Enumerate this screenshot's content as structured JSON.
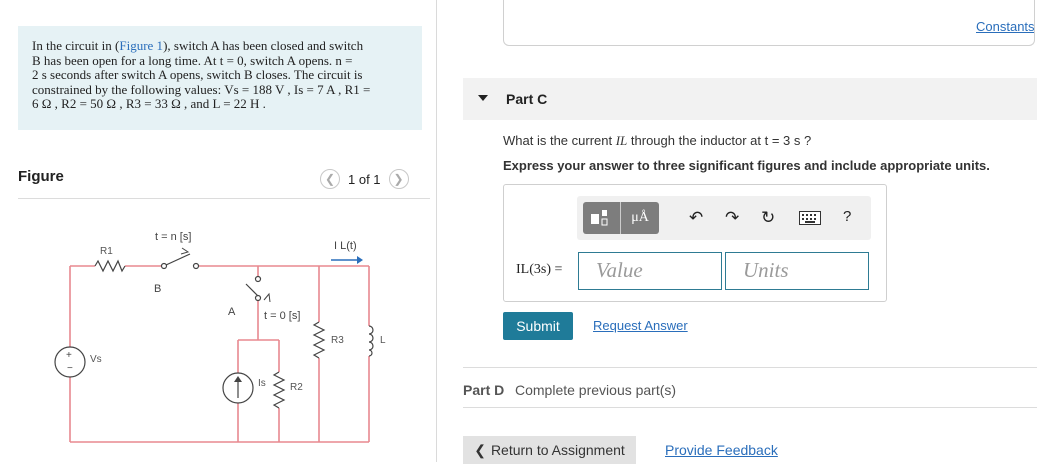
{
  "problem": {
    "figure_link": "Figure 1",
    "line1_pre": "In the circuit in (",
    "line1_post": "), switch A has been closed and switch",
    "line2": "B has been open for a long time. At t = 0, switch A opens. n =",
    "line3": "2 s  seconds after switch A opens, switch B closes. The circuit is",
    "line4": "constrained by the following values: Vs = 188 V , Is = 7 A , R1 =",
    "line5": "6 Ω , R2 = 50 Ω , R3 = 33 Ω , and L = 22 H ."
  },
  "figure": {
    "label": "Figure",
    "page_indicator": "1 of 1",
    "circuit_labels": {
      "r1": "R1",
      "switch_b_time": "t = n [s]",
      "switch_b": "B",
      "switch_a": "A",
      "switch_a_time": "t = 0 [s]",
      "current": "I L(t)",
      "vs": "Vs",
      "is": "Is",
      "r2": "R2",
      "r3": "R3",
      "l": "L"
    }
  },
  "header": {
    "constants_link": "Constants"
  },
  "part_c": {
    "label": "Part C",
    "question_pre": "What is the current ",
    "question_var": "IL",
    "question_post": " through the inductor at t = 3 s ?",
    "instruction": "Express your answer to three significant figures and include appropriate units.",
    "answer_lhs": "IL(3s) =",
    "value_placeholder": "Value",
    "units_placeholder": "Units",
    "toolbar": {
      "mu_label": "μÅ",
      "help": "?"
    },
    "submit_label": "Submit",
    "request_answer_label": "Request Answer"
  },
  "part_d": {
    "label": "Part D",
    "text": "Complete previous part(s)"
  },
  "footer": {
    "return_label": "Return to Assignment",
    "feedback_label": "Provide Feedback"
  },
  "colors": {
    "wire": "#e8898f",
    "link": "#2a6ebb",
    "submit": "#1f7b99",
    "problem_bg": "#e6f2f5"
  },
  "icons": [
    "caret-down-icon",
    "template-icon",
    "undo-icon",
    "redo-icon",
    "reset-icon",
    "keyboard-icon",
    "help-icon",
    "chevron-left-icon",
    "chevron-right-icon"
  ]
}
